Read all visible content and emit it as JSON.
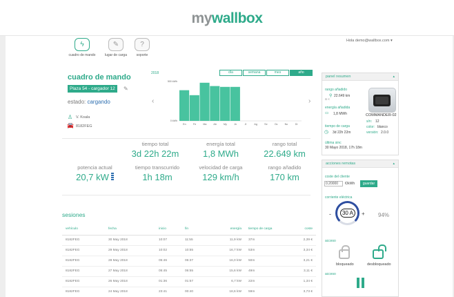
{
  "brand": {
    "part1": "my",
    "part2": "wallbox"
  },
  "nav": [
    {
      "label": "cuadro de mando",
      "icon": "bolt-icon"
    },
    {
      "label": "lugar de carga",
      "icon": "wrench-icon"
    },
    {
      "label": "soporte",
      "icon": "question-icon"
    }
  ],
  "user_email": "Hola demo@wallbox.com ▾",
  "dashboard": {
    "title": "cuadro de mando",
    "place": "Plaza 54 - cargador 12",
    "status_label": "estado:",
    "status_value": "cargando",
    "driver": "V. Koala",
    "plate": "8182FEG",
    "year": "2018",
    "ranges": [
      "día",
      "semana",
      "mes",
      "año"
    ],
    "selected_range": "año"
  },
  "chart_data": {
    "type": "bar",
    "categories": [
      "En",
      "Fe",
      "Ma",
      "Ab",
      "My",
      "Jn",
      "Jl",
      "Ag",
      "Se",
      "Oc",
      "No",
      "Di"
    ],
    "values": [
      370,
      310,
      460,
      420,
      410,
      410,
      0,
      0,
      0,
      0,
      0,
      0
    ],
    "ylim": [
      0,
      500
    ],
    "ytick_labels": [
      "500 kWh",
      "0 kWh"
    ],
    "color": "#48c39f"
  },
  "stats": {
    "tiempo_total_label": "tiempo total",
    "tiempo_total": "3d 22h 22m",
    "energia_total_label": "energía total",
    "energia_total": "1,8 MWh",
    "rango_total_label": "rango total",
    "rango_total": "22.649 km",
    "potencia_label": "potencia actual",
    "potencia": "20,7 kW",
    "transcurrido_label": "tiempo transcurrido",
    "transcurrido": "1h 18m",
    "velocidad_label": "velocidad de carga",
    "velocidad": "129 km/h",
    "anadido_label": "rango añadido",
    "anadido": "170 km"
  },
  "sessions": {
    "title": "sesiones",
    "headers": [
      "vehículo",
      "fecha",
      "inicio",
      "fin",
      "energía",
      "tiempo de carga",
      "coste"
    ],
    "rows": [
      [
        "8182FEG",
        "30 May 2018",
        "10:07",
        "11:55",
        "11,9 kW",
        "37m",
        "2,39 €"
      ],
      [
        "8182FEG",
        "29 May 2018",
        "10:02",
        "10:55",
        "16,7 kW",
        "53m",
        "3,34 €"
      ],
      [
        "8182FEG",
        "28 May 2018",
        "05:46",
        "06:37",
        "16,0 kW",
        "50m",
        "3,21 €"
      ],
      [
        "8182FEG",
        "27 May 2018",
        "05:45",
        "06:55",
        "15,6 kW",
        "49m",
        "3,11 €"
      ],
      [
        "8182FEG",
        "26 May 2018",
        "01:36",
        "01:57",
        "6,7 kW",
        "22m",
        "1,34 €"
      ],
      [
        "8182FEG",
        "24 May 2018",
        "23:41",
        "00:40",
        "18,6 kW",
        "59m",
        "3,73 €"
      ]
    ]
  },
  "resumen": {
    "title": "panel resumen",
    "rango_label": "rango añadido",
    "rango_value": "22.649 km",
    "rango_note": "a «",
    "energia_label": "energía añadida",
    "energia_value": "1,8 MWh",
    "tiempo_label": "tiempo de carga",
    "tiempo_value": "3d 22h 22m",
    "sync_label": "última sinc",
    "sync_value": "30 Mayo 2018, 17h 18m",
    "device_name": "COMMANDER-02",
    "sn_label": "s/n:",
    "sn_value": "12",
    "color_label": "color:",
    "color_value": "blanco",
    "version_label": "versión:",
    "version_value": "2.0.0"
  },
  "acciones": {
    "title": "acciones remotas",
    "coste_label": "coste del cliente",
    "price_value": "0.20000",
    "unit": "€/kWh",
    "save": "guardar",
    "corriente_label": "corriente eléctrica",
    "minus": "-",
    "plus": "+",
    "current": "30 A",
    "percent": "94%",
    "acceso_label": "acceso",
    "bloqueado": "bloqueado",
    "desbloqueado": "desbloqueado",
    "acceso2_label": "acceso"
  }
}
